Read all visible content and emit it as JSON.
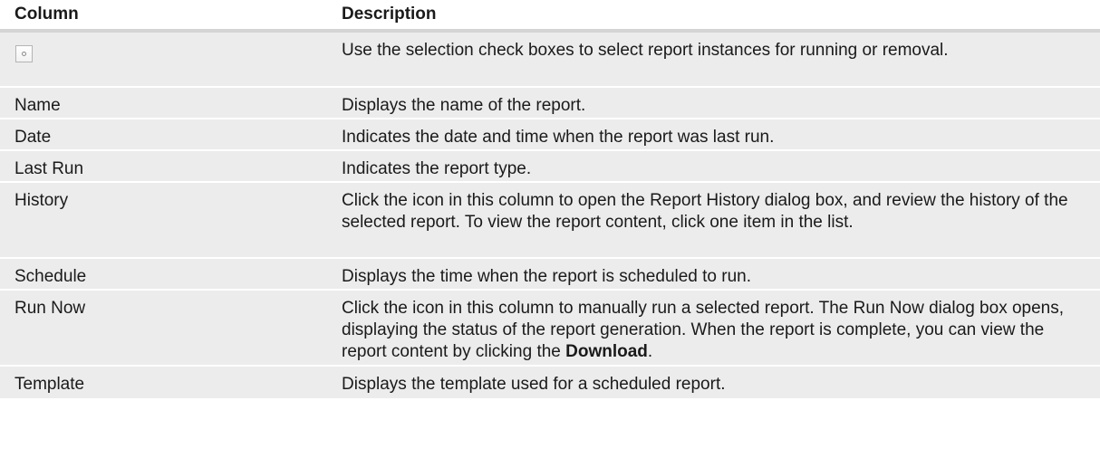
{
  "table": {
    "headers": {
      "column": "Column",
      "description": "Description"
    },
    "rows": [
      {
        "column": "",
        "icon": "checkbox-icon",
        "description": "Use the selection check boxes to select report instances for running or removal."
      },
      {
        "column": "Name",
        "description": "Displays the name of the report."
      },
      {
        "column": "Date",
        "description": "Indicates the date and time when the report was last run."
      },
      {
        "column": "Last Run",
        "description": "Indicates the report type."
      },
      {
        "column": "History",
        "description": "Click the icon in this column to open the Report History dialog box, and review the history of the selected report. To view the report content, click one item in the list."
      },
      {
        "column": "Schedule",
        "description": "Displays the time when the report is scheduled to run."
      },
      {
        "column": "Run Now",
        "description_pre": "Click the icon in this column to manually run a selected report. The Run Now dialog box opens, displaying the status of the report generation. When the report is complete, you can view the report content by clicking the ",
        "description_bold": "Download",
        "description_post": "."
      },
      {
        "column": "Template",
        "description": "Displays the template used for a scheduled report."
      }
    ]
  },
  "colors": {
    "row_background": "#ececec",
    "header_border": "#d4d4d4",
    "text": "#1a1a1a"
  }
}
